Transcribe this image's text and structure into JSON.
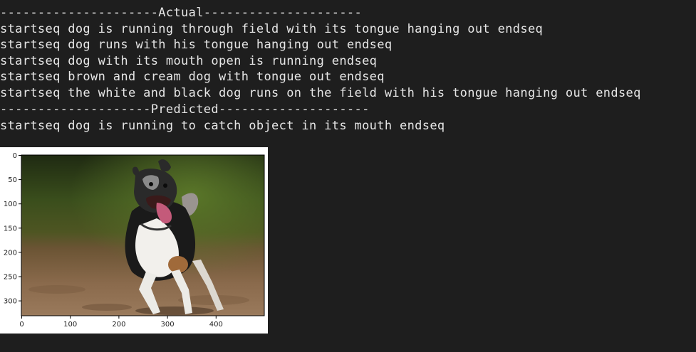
{
  "output": {
    "lines": [
      "---------------------Actual---------------------",
      "startseq dog is running through field with its tongue hanging out endseq",
      "startseq dog runs with his tongue hanging out endseq",
      "startseq dog with its mouth open is running endseq",
      "startseq brown and cream dog with tongue out endseq",
      "startseq the white and black dog runs on the field with his tongue hanging out endseq",
      "--------------------Predicted--------------------",
      "startseq dog is running to catch object in its mouth endseq"
    ]
  },
  "colors": {
    "background": "#1e1e1e",
    "text": "#e6e6e6",
    "plot_background": "#ffffff"
  },
  "plot": {
    "x_ticks": [
      "0",
      "100",
      "200",
      "300",
      "400"
    ],
    "y_ticks": [
      "0",
      "50",
      "100",
      "150",
      "200",
      "250",
      "300"
    ]
  }
}
